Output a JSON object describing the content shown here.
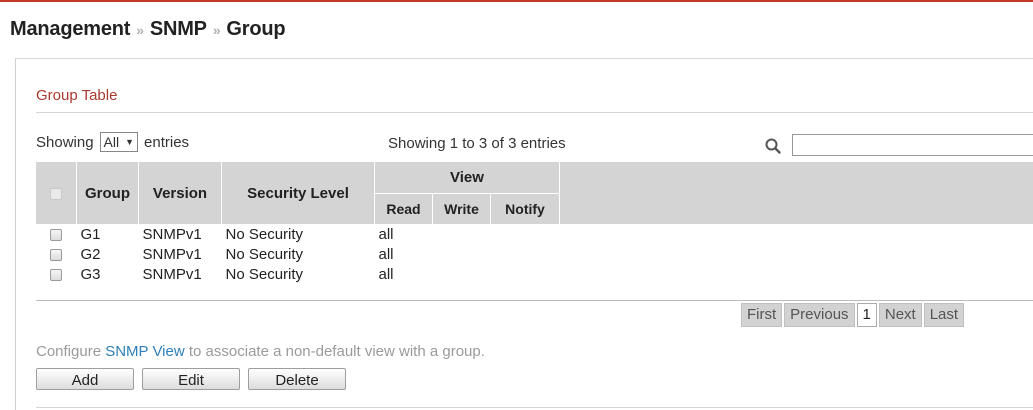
{
  "breadcrumb": {
    "items": [
      "Management",
      "SNMP",
      "Group"
    ],
    "separator": "»"
  },
  "section": {
    "title": "Group Table"
  },
  "controls": {
    "showing_prefix": "Showing",
    "entries_select_value": "All",
    "showing_suffix": "entries",
    "info": "Showing 1 to 3 of 3 entries"
  },
  "table": {
    "headers": {
      "group": "Group",
      "version": "Version",
      "security_level": "Security Level",
      "view": "View",
      "read": "Read",
      "write": "Write",
      "notify": "Notify"
    },
    "rows": [
      {
        "group": "G1",
        "version": "SNMPv1",
        "security_level": "No Security",
        "read": "all",
        "write": "",
        "notify": ""
      },
      {
        "group": "G2",
        "version": "SNMPv1",
        "security_level": "No Security",
        "read": "all",
        "write": "",
        "notify": ""
      },
      {
        "group": "G3",
        "version": "SNMPv1",
        "security_level": "No Security",
        "read": "all",
        "write": "",
        "notify": ""
      }
    ]
  },
  "pagination": {
    "first": "First",
    "previous": "Previous",
    "current": "1",
    "next": "Next",
    "last": "Last"
  },
  "note": {
    "prefix": "Configure",
    "link": "SNMP View",
    "suffix": "to associate a non-default view with a group."
  },
  "actions": {
    "add": "Add",
    "edit": "Edit",
    "delete": "Delete"
  },
  "icons": {
    "search": "search-icon",
    "dropdown": "chevron-down-icon"
  },
  "colors": {
    "section_title": "#a83a2e",
    "link": "#2d7fb8",
    "header_bg": "#d4d4d4"
  }
}
